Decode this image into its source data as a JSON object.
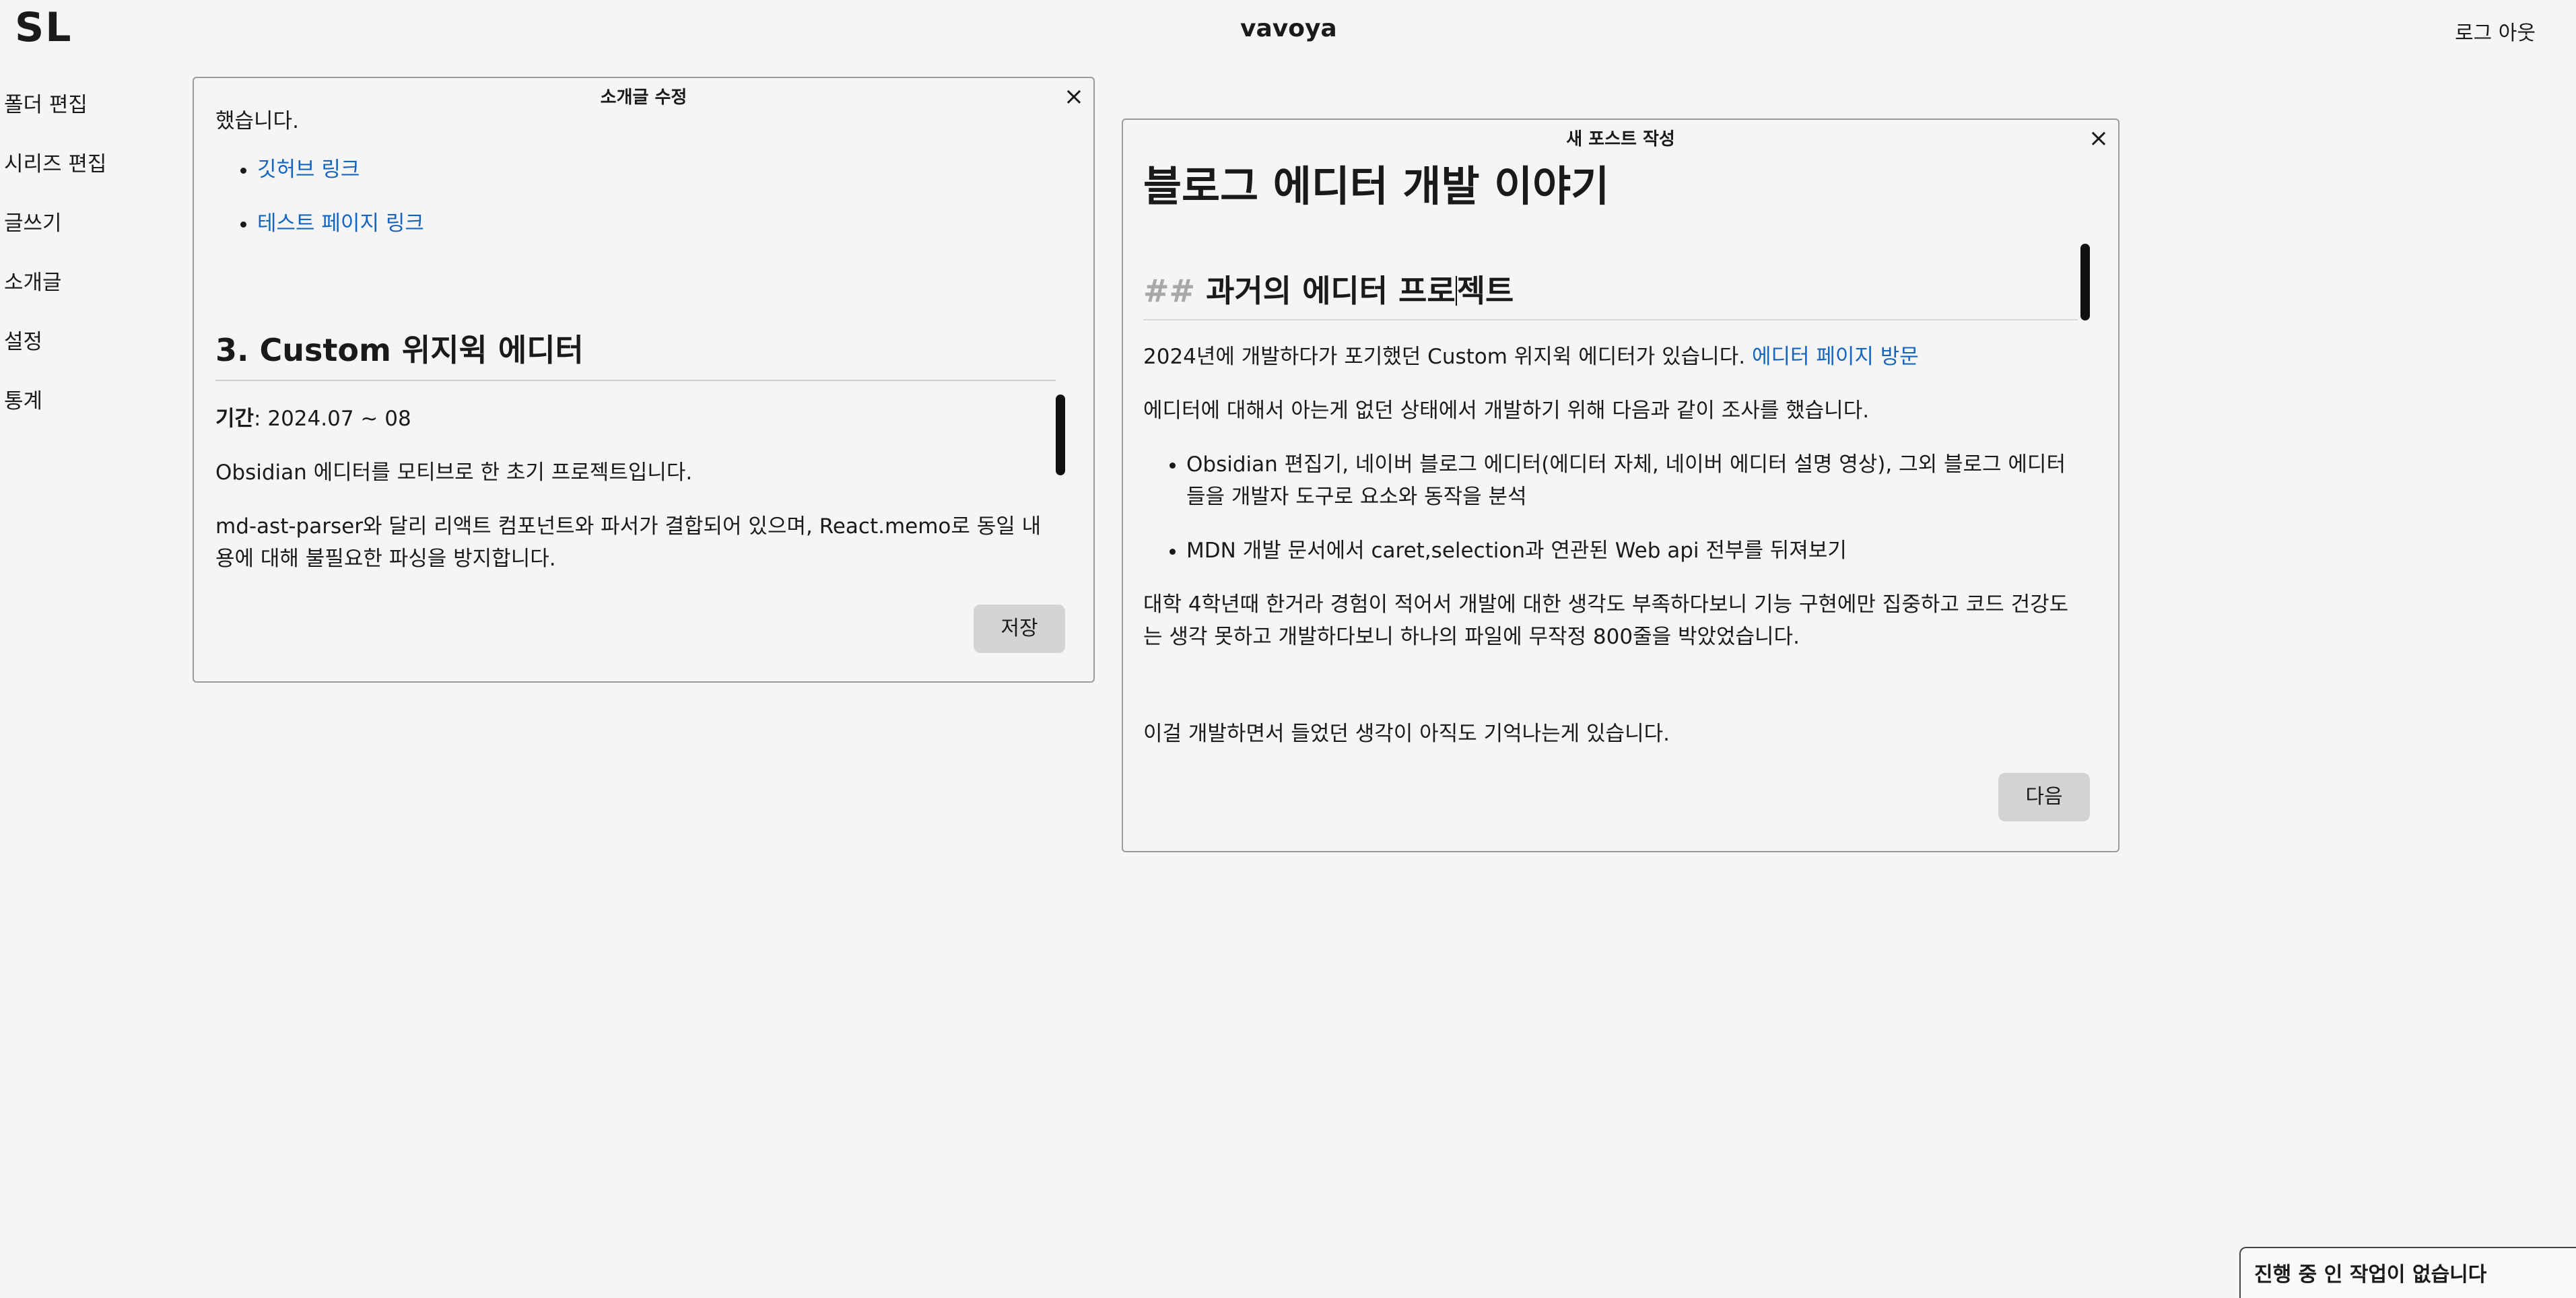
{
  "header": {
    "logo": "SL",
    "site_title": "vavoya",
    "logout_label": "로그 아웃"
  },
  "sidebar": {
    "items": [
      {
        "label": "폴더 편집"
      },
      {
        "label": "시리즈 편집"
      },
      {
        "label": "글쓰기"
      },
      {
        "label": "소개글"
      },
      {
        "label": "설정"
      },
      {
        "label": "통계"
      }
    ]
  },
  "intro_modal": {
    "title": "소개글 수정",
    "close_icon": "×",
    "fragment": "했습니다.",
    "links": [
      "깃허브 링크",
      "테스트 페이지 링크"
    ],
    "section_heading": "3. Custom 위지윅 에디터",
    "period_label": "기간",
    "period_value": ": 2024.07 ~ 08",
    "para1": "Obsidian 에디터를 모티브로 한 초기 프로젝트입니다.",
    "para2": "md-ast-parser와 달리 리액트 컴포넌트와 파서가 결합되어 있으며, React.memo로 동일 내용에 대해 불필요한 파싱을 방지합니다.",
    "save_label": "저장"
  },
  "post_modal": {
    "title": "새 포스트 작성",
    "close_icon": "×",
    "post_title": "블로그 에디터 개발 이야기",
    "h2_marker": "##",
    "h2_text_before_caret": "과거의 에디터 프로",
    "h2_text_after_caret": "젝트",
    "para1": "2024년에 개발하다가 포기했던 Custom 위지윅 에디터가 있습니다.",
    "para1_link": "에디터 페이지 방문",
    "para2": "에디터에 대해서 아는게 없던 상태에서 개발하기 위해 다음과 같이 조사를 했습니다.",
    "bullets": [
      "Obsidian 편집기, 네이버 블로그 에디터(에디터 자체, 네이버 에디터 설명 영상), 그외 블로그 에디터들을 개발자 도구로 요소와 동작을 분석",
      "MDN 개발 문서에서 caret,selection과 연관된 Web api 전부를 뒤져보기"
    ],
    "para3": "대학 4학년때 한거라 경험이 적어서 개발에 대한 생각도 부족하다보니 기능 구현에만 집중하고 코드 건강도는 생각 못하고 개발하다보니 하나의 파일에 무작정 800줄을 박았었습니다.",
    "para4": "이걸 개발하면서 들었던 생각이 아직도 기억나는게 있습니다.",
    "next_label": "다음"
  },
  "status": {
    "text": "진행 중 인 작업이 없습니다"
  }
}
